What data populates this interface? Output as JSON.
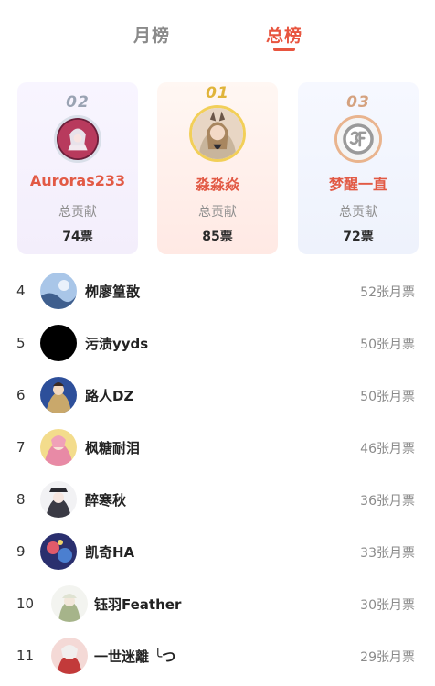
{
  "tabs": {
    "monthly": "月榜",
    "total": "总榜"
  },
  "podium": {
    "label": "总贡献",
    "first": {
      "rank": "01",
      "name": "淼淼焱",
      "votes": "85票"
    },
    "second": {
      "rank": "02",
      "name": "Auroras233",
      "votes": "74票"
    },
    "third": {
      "rank": "03",
      "name": "梦醒一直",
      "votes": "72票"
    }
  },
  "list": [
    {
      "rank": "4",
      "name": "栁廖篁敔",
      "votes": "52张月票"
    },
    {
      "rank": "5",
      "name": "污渍yyds",
      "votes": "50张月票"
    },
    {
      "rank": "6",
      "name": "路人DZ",
      "votes": "50张月票"
    },
    {
      "rank": "7",
      "name": "枫糖耐泪",
      "votes": "46张月票"
    },
    {
      "rank": "8",
      "name": "醉寒秋",
      "votes": "36张月票"
    },
    {
      "rank": "9",
      "name": "凯奇HA",
      "votes": "33张月票"
    },
    {
      "rank": "10",
      "name": "钰羽Feather",
      "votes": "30张月票"
    },
    {
      "rank": "11",
      "name": "一世迷離 ╰つ",
      "votes": "29张月票"
    }
  ],
  "colors": {
    "accent": "#e8553f",
    "inactive_tab": "#8a8a8a",
    "gold": "#e0b43a",
    "silver": "#9aa3b3",
    "bronze": "#d5a27f"
  }
}
